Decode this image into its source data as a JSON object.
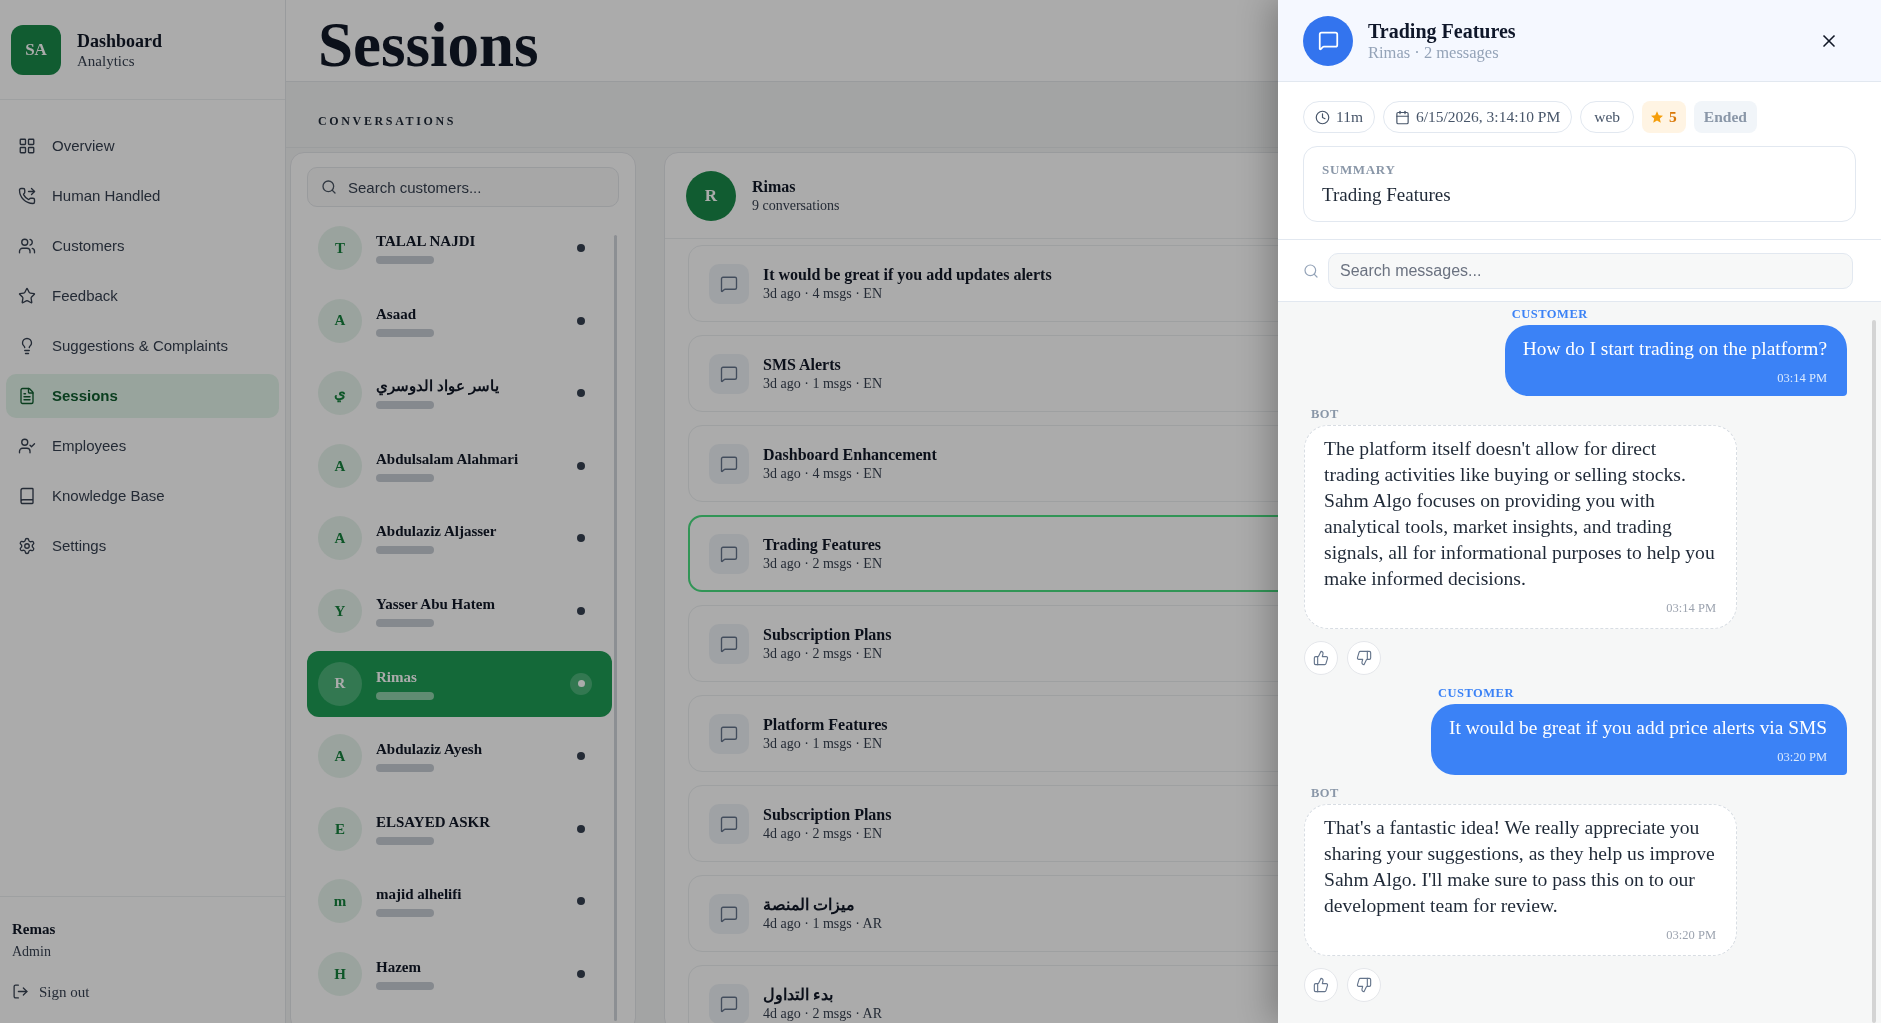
{
  "sidebar": {
    "logo": "SA",
    "title": "Dashboard",
    "subtitle": "Analytics",
    "items": [
      {
        "label": "Overview",
        "selected": false
      },
      {
        "label": "Human Handled",
        "selected": false
      },
      {
        "label": "Customers",
        "selected": false
      },
      {
        "label": "Feedback",
        "selected": false
      },
      {
        "label": "Suggestions & Complaints",
        "selected": false
      },
      {
        "label": "Sessions",
        "selected": true
      },
      {
        "label": "Employees",
        "selected": false
      },
      {
        "label": "Knowledge Base",
        "selected": false
      },
      {
        "label": "Settings",
        "selected": false
      }
    ],
    "user": {
      "name": "Remas",
      "role": "Admin"
    },
    "sign_out": "Sign out"
  },
  "page": {
    "title": "Sessions"
  },
  "conversations": {
    "heading": "CONVERSATIONS",
    "search": {
      "placeholder": "Search customers..."
    },
    "customers": [
      {
        "initial": "T",
        "name": "TALAL NAJDI",
        "selected": false
      },
      {
        "initial": "A",
        "name": "Asaad",
        "selected": false
      },
      {
        "initial": "ي",
        "name": "ياسر عواد الدوسري",
        "selected": false
      },
      {
        "initial": "A",
        "name": "Abdulsalam Alahmari",
        "selected": false
      },
      {
        "initial": "A",
        "name": "Abdulaziz Aljasser",
        "selected": false
      },
      {
        "initial": "Y",
        "name": "Yasser Abu Hatem",
        "selected": false
      },
      {
        "initial": "R",
        "name": "Rimas",
        "selected": true
      },
      {
        "initial": "A",
        "name": "Abdulaziz Ayesh",
        "selected": false
      },
      {
        "initial": "E",
        "name": "ELSAYED ASKR",
        "selected": false
      },
      {
        "initial": "m",
        "name": "majid alhelifi",
        "selected": false
      },
      {
        "initial": "H",
        "name": "Hazem",
        "selected": false
      }
    ]
  },
  "customer_sessions": {
    "initial": "R",
    "name": "Rimas",
    "subtitle": "9 conversations",
    "items": [
      {
        "title": "It would be great if you add updates alerts",
        "meta": "3d ago · 4 msgs · EN",
        "selected": false
      },
      {
        "title": "SMS Alerts",
        "meta": "3d ago · 1 msgs · EN",
        "selected": false
      },
      {
        "title": "Dashboard Enhancement",
        "meta": "3d ago · 4 msgs · EN",
        "selected": false
      },
      {
        "title": "Trading Features",
        "meta": "3d ago · 2 msgs · EN",
        "selected": true
      },
      {
        "title": "Subscription Plans",
        "meta": "3d ago · 2 msgs · EN",
        "selected": false
      },
      {
        "title": "Platform Features",
        "meta": "3d ago · 1 msgs · EN",
        "selected": false
      },
      {
        "title": "Subscription Plans",
        "meta": "4d ago · 2 msgs · EN",
        "selected": false
      },
      {
        "title": "ميزات المنصة",
        "meta": "4d ago · 1 msgs · AR",
        "selected": false
      },
      {
        "title": "بدء التداول",
        "meta": "4d ago · 2 msgs · AR",
        "selected": false
      }
    ]
  },
  "detail": {
    "title": "Trading Features",
    "subtitle": "Rimas · 2 messages",
    "chips": [
      {
        "kind": "duration",
        "text": "11m"
      },
      {
        "kind": "date",
        "text": "6/15/2026, 3:14:10 PM"
      },
      {
        "kind": "channel",
        "text": "web"
      },
      {
        "kind": "rating",
        "text": "5"
      },
      {
        "kind": "status",
        "text": "Ended"
      }
    ],
    "summary": {
      "label": "SUMMARY",
      "text": "Trading Features"
    },
    "search": {
      "placeholder": "Search messages..."
    },
    "messages": [
      {
        "kind": "customer",
        "label": "CUSTOMER",
        "text": "How do I start trading on the platform?",
        "time": "03:14 PM"
      },
      {
        "kind": "bot",
        "label": "BOT",
        "text": "The platform itself doesn't allow for direct trading activities like buying or selling stocks. Sahm Algo focuses on providing you with analytical tools, market insights, and trading signals, all for informational purposes to help you make informed decisions.",
        "time": "03:14 PM"
      },
      {
        "kind": "customer",
        "label": "CUSTOMER",
        "text": "It would be great if you add price alerts via SMS",
        "time": "03:20 PM"
      },
      {
        "kind": "bot",
        "label": "BOT",
        "text": "That's a fantastic idea! We really appreciate you sharing your suggestions, as they help us improve Sahm Algo. I'll make sure to pass this on to our development team for review.",
        "time": "03:20 PM"
      }
    ]
  }
}
